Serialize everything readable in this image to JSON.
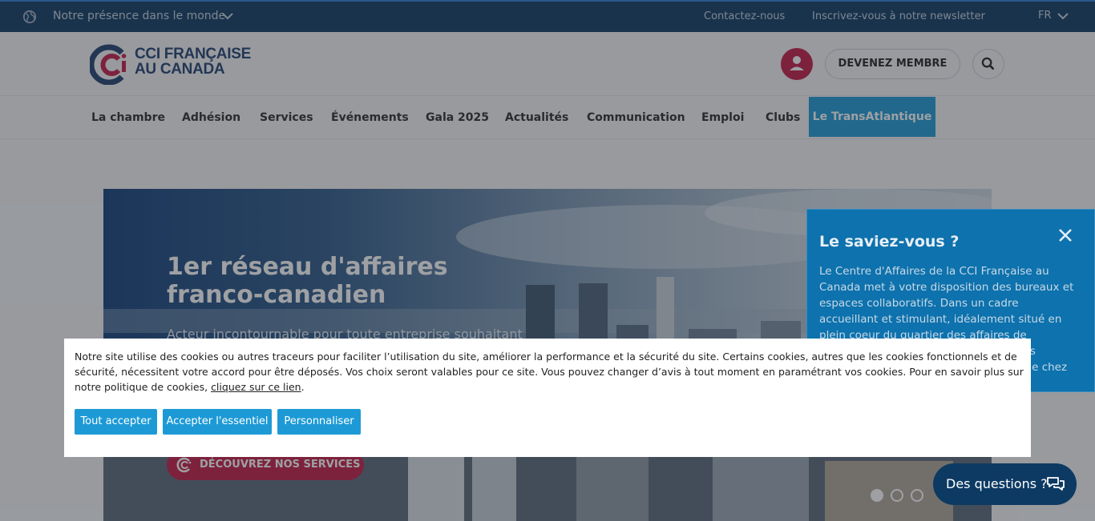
{
  "topbar": {
    "presence_label": "Notre présence dans le monde",
    "contact_label": "Contactez-nous",
    "newsletter_label": "Inscrivez-vous à notre newsletter",
    "language": "FR"
  },
  "header": {
    "logo_line1": "CCI FRANÇAISE",
    "logo_line2": "AU CANADA",
    "member_label": "DEVENEZ MEMBRE"
  },
  "nav": {
    "items": [
      "La chambre",
      "Adhésion",
      "Services",
      "Événements",
      "Gala 2025",
      "Actualités",
      "Communication",
      "Emploi",
      "Clubs"
    ],
    "highlight": "Le TransAtlantique"
  },
  "hero": {
    "title_line1": "1er réseau d'affaires",
    "title_line2": "franco-canadien",
    "subtitle": "Acteur incontournable pour toute entreprise souhaitant",
    "cta_label": "DÉCOUVREZ NOS SERVICES",
    "slide_count": 3,
    "active_slide": 1
  },
  "panel": {
    "title": "Le saviez-vous ?",
    "text": "Le Centre d'Affaires de la CCI Française au Canada met à votre disposition des bureaux et espaces collaboratifs. Dans un cadre accueillant et stimulant, idéalement situé en plein coeur du quartier des affaires de Montréal, nous vous accueillons et vous hébergez en toute simplicité. Bienvenue chez vous, bienvenue à l'accueil !"
  },
  "cookie": {
    "text_before_link": "Notre site utilise des cookies ou autres traceurs pour faciliter l’utilisation du site, améliorer la performance et la sécurité du site. Certains cookies, autres que les cookies fonctionnels et de sécurité, nécessitent votre accord pour être déposés. Vos choix seront valables pour ce site. Vous pouvez changer d’avis à tout moment en paramétrant vos cookies. Pour en savoir plus sur notre politique de cookies, ",
    "link_text": "cliquez sur ce lien",
    "text_after_link": ".",
    "accept_all": "Tout accepter",
    "accept_essential": "Accepter l'essentiel",
    "customize": "Personnaliser"
  },
  "chat": {
    "label": "Des questions ?"
  },
  "colors": {
    "topbar": "#0d3a63",
    "accent_blue": "#1d9ad6",
    "brand_red": "#c41a45",
    "panel_blue": "#0d72ad"
  },
  "icons": [
    "globe-icon",
    "chevron-down-icon",
    "user-icon",
    "search-icon",
    "close-icon",
    "chat-icon",
    "cci-logo-icon"
  ]
}
